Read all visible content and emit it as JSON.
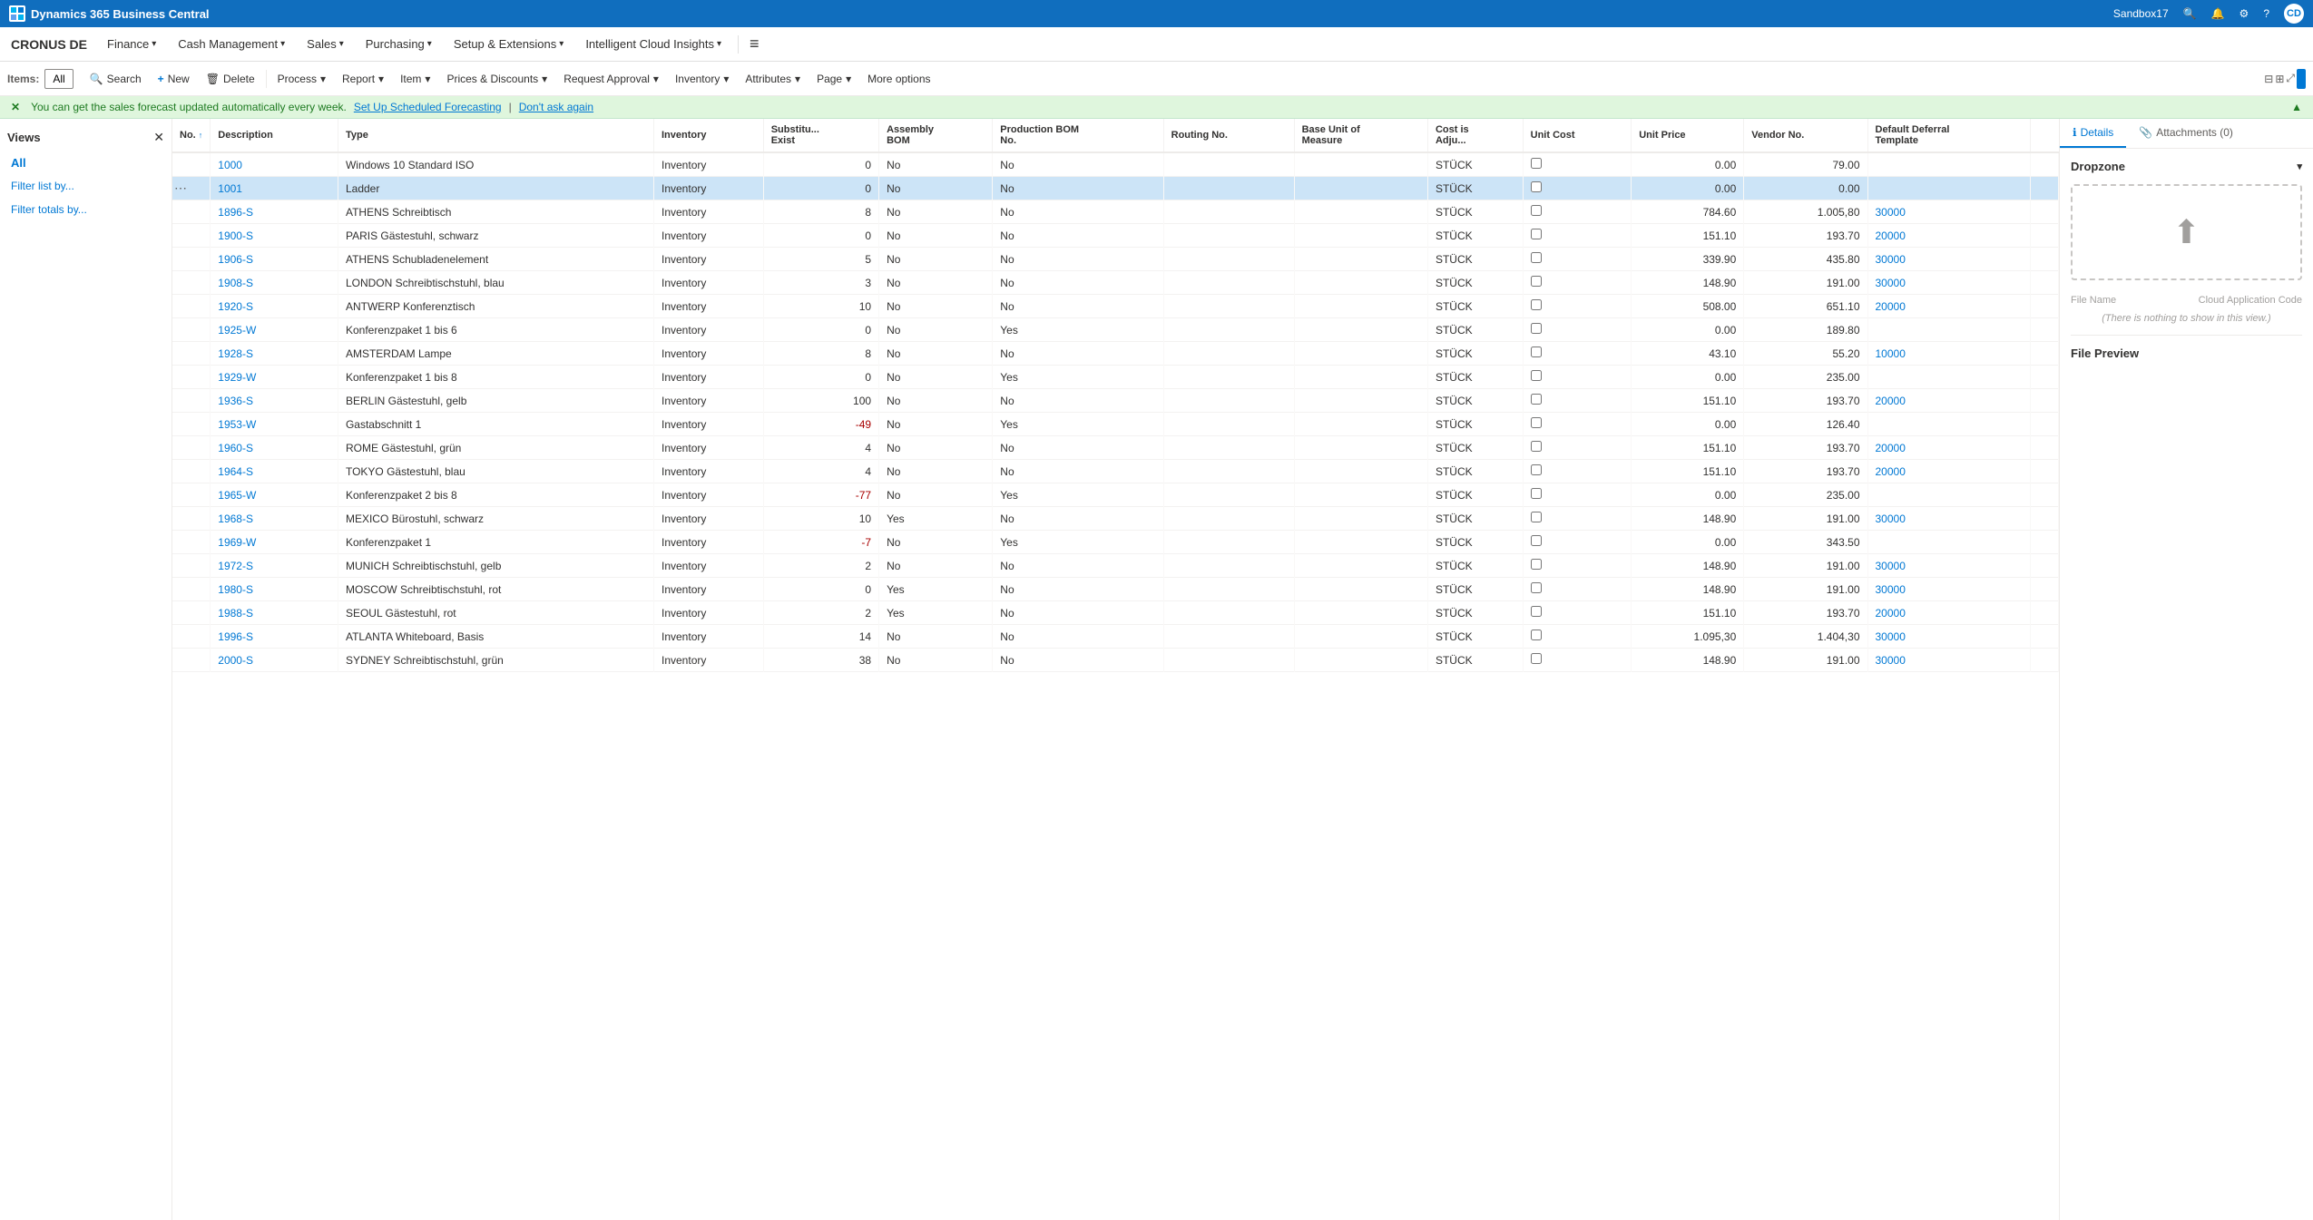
{
  "topBar": {
    "appName": "Dynamics 365 Business Central",
    "sandboxLabel": "Sandbox17",
    "searchIcon": "🔍",
    "bellIcon": "🔔",
    "settingsIcon": "⚙",
    "helpIcon": "?",
    "userIcon": "👤"
  },
  "navBar": {
    "companyName": "CRONUS DE",
    "items": [
      {
        "label": "Finance",
        "hasChevron": true
      },
      {
        "label": "Cash Management",
        "hasChevron": true
      },
      {
        "label": "Sales",
        "hasChevron": true
      },
      {
        "label": "Purchasing",
        "hasChevron": true
      },
      {
        "label": "Setup & Extensions",
        "hasChevron": true
      },
      {
        "label": "Intelligent Cloud Insights",
        "hasChevron": true
      }
    ]
  },
  "toolbar": {
    "itemsLabel": "Items:",
    "filterAll": "All",
    "buttons": [
      {
        "id": "search",
        "icon": "🔍",
        "label": "Search"
      },
      {
        "id": "new",
        "icon": "+",
        "label": "New"
      },
      {
        "id": "delete",
        "icon": "🗑",
        "label": "Delete"
      },
      {
        "id": "process",
        "icon": "",
        "label": "Process",
        "hasChevron": true
      },
      {
        "id": "report",
        "icon": "",
        "label": "Report",
        "hasChevron": true
      },
      {
        "id": "item",
        "icon": "",
        "label": "Item",
        "hasChevron": true
      },
      {
        "id": "prices",
        "icon": "",
        "label": "Prices & Discounts",
        "hasChevron": true
      },
      {
        "id": "approval",
        "icon": "",
        "label": "Request Approval",
        "hasChevron": true
      },
      {
        "id": "inventory",
        "icon": "",
        "label": "Inventory",
        "hasChevron": true
      },
      {
        "id": "attributes",
        "icon": "",
        "label": "Attributes",
        "hasChevron": true
      },
      {
        "id": "page",
        "icon": "",
        "label": "Page",
        "hasChevron": true
      },
      {
        "id": "more",
        "icon": "",
        "label": "More options"
      }
    ]
  },
  "banner": {
    "message": "You can get the sales forecast updated automatically every week.",
    "linkText": "Set Up Scheduled Forecasting",
    "dismissText": "Don't ask again"
  },
  "sidebar": {
    "title": "Views",
    "activeView": "All",
    "links": [
      {
        "label": "Filter list by..."
      },
      {
        "label": "Filter totals by..."
      }
    ]
  },
  "table": {
    "columns": [
      {
        "id": "no",
        "label": "No. ↑"
      },
      {
        "id": "description",
        "label": "Description"
      },
      {
        "id": "type",
        "label": "Type"
      },
      {
        "id": "inventory",
        "label": "Inventory"
      },
      {
        "id": "subst",
        "label": "Substitu... Exist"
      },
      {
        "id": "assembly",
        "label": "Assembly BOM"
      },
      {
        "id": "production",
        "label": "Production BOM No."
      },
      {
        "id": "routing",
        "label": "Routing No."
      },
      {
        "id": "baseunit",
        "label": "Base Unit of Measure"
      },
      {
        "id": "costadj",
        "label": "Cost is Adju..."
      },
      {
        "id": "unitcost",
        "label": "Unit Cost"
      },
      {
        "id": "unitprice",
        "label": "Unit Price"
      },
      {
        "id": "vendor",
        "label": "Vendor No."
      },
      {
        "id": "deferral",
        "label": "Default Deferral Template"
      }
    ],
    "rows": [
      {
        "no": "1000",
        "description": "Windows 10 Standard ISO",
        "type": "Inventory",
        "inventory": "0",
        "subst": "No",
        "assembly": "No",
        "production": "",
        "routing": "",
        "baseunit": "STÜCK",
        "costadj": "",
        "unitcost": "0.00",
        "unitprice": "79.00",
        "vendor": "",
        "deferral": "",
        "selected": false
      },
      {
        "no": "1001",
        "description": "Ladder",
        "type": "Inventory",
        "inventory": "0",
        "subst": "No",
        "assembly": "No",
        "production": "",
        "routing": "",
        "baseunit": "STÜCK",
        "costadj": "",
        "unitcost": "0.00",
        "unitprice": "0.00",
        "vendor": "",
        "deferral": "",
        "selected": true
      },
      {
        "no": "1896-S",
        "description": "ATHENS Schreibtisch",
        "type": "Inventory",
        "inventory": "8",
        "subst": "No",
        "assembly": "No",
        "production": "",
        "routing": "",
        "baseunit": "STÜCK",
        "costadj": "",
        "unitcost": "784.60",
        "unitprice": "1.005,80",
        "vendor": "30000",
        "deferral": "",
        "selected": false
      },
      {
        "no": "1900-S",
        "description": "PARIS Gästestuhl, schwarz",
        "type": "Inventory",
        "inventory": "0",
        "subst": "No",
        "assembly": "No",
        "production": "",
        "routing": "",
        "baseunit": "STÜCK",
        "costadj": "",
        "unitcost": "151.10",
        "unitprice": "193.70",
        "vendor": "20000",
        "deferral": "",
        "selected": false
      },
      {
        "no": "1906-S",
        "description": "ATHENS Schubladenelement",
        "type": "Inventory",
        "inventory": "5",
        "subst": "No",
        "assembly": "No",
        "production": "",
        "routing": "",
        "baseunit": "STÜCK",
        "costadj": "",
        "unitcost": "339.90",
        "unitprice": "435.80",
        "vendor": "30000",
        "deferral": "",
        "selected": false
      },
      {
        "no": "1908-S",
        "description": "LONDON Schreibtischstuhl, blau",
        "type": "Inventory",
        "inventory": "3",
        "subst": "No",
        "assembly": "No",
        "production": "",
        "routing": "",
        "baseunit": "STÜCK",
        "costadj": "",
        "unitcost": "148.90",
        "unitprice": "191.00",
        "vendor": "30000",
        "deferral": "",
        "selected": false
      },
      {
        "no": "1920-S",
        "description": "ANTWERP Konferenztisch",
        "type": "Inventory",
        "inventory": "10",
        "subst": "No",
        "assembly": "No",
        "production": "",
        "routing": "",
        "baseunit": "STÜCK",
        "costadj": "",
        "unitcost": "508.00",
        "unitprice": "651.10",
        "vendor": "20000",
        "deferral": "",
        "selected": false
      },
      {
        "no": "1925-W",
        "description": "Konferenzpaket 1 bis 6",
        "type": "Inventory",
        "inventory": "0",
        "subst": "No",
        "assembly": "Yes",
        "production": "",
        "routing": "",
        "baseunit": "STÜCK",
        "costadj": "",
        "unitcost": "0.00",
        "unitprice": "189.80",
        "vendor": "",
        "deferral": "",
        "selected": false
      },
      {
        "no": "1928-S",
        "description": "AMSTERDAM Lampe",
        "type": "Inventory",
        "inventory": "8",
        "subst": "No",
        "assembly": "No",
        "production": "",
        "routing": "",
        "baseunit": "STÜCK",
        "costadj": "",
        "unitcost": "43.10",
        "unitprice": "55.20",
        "vendor": "10000",
        "deferral": "",
        "selected": false
      },
      {
        "no": "1929-W",
        "description": "Konferenzpaket 1 bis 8",
        "type": "Inventory",
        "inventory": "0",
        "subst": "No",
        "assembly": "Yes",
        "production": "",
        "routing": "",
        "baseunit": "STÜCK",
        "costadj": "",
        "unitcost": "0.00",
        "unitprice": "235.00",
        "vendor": "",
        "deferral": "",
        "selected": false
      },
      {
        "no": "1936-S",
        "description": "BERLIN Gästestuhl, gelb",
        "type": "Inventory",
        "inventory": "100",
        "subst": "No",
        "assembly": "No",
        "production": "",
        "routing": "",
        "baseunit": "STÜCK",
        "costadj": "",
        "unitcost": "151.10",
        "unitprice": "193.70",
        "vendor": "20000",
        "deferral": "",
        "selected": false
      },
      {
        "no": "1953-W",
        "description": "Gastabschnitt 1",
        "type": "Inventory",
        "inventory": "-49",
        "subst": "No",
        "assembly": "Yes",
        "production": "",
        "routing": "",
        "baseunit": "STÜCK",
        "costadj": "",
        "unitcost": "0.00",
        "unitprice": "126.40",
        "vendor": "",
        "deferral": "",
        "selected": false
      },
      {
        "no": "1960-S",
        "description": "ROME Gästestuhl, grün",
        "type": "Inventory",
        "inventory": "4",
        "subst": "No",
        "assembly": "No",
        "production": "",
        "routing": "",
        "baseunit": "STÜCK",
        "costadj": "",
        "unitcost": "151.10",
        "unitprice": "193.70",
        "vendor": "20000",
        "deferral": "",
        "selected": false
      },
      {
        "no": "1964-S",
        "description": "TOKYO Gästestuhl, blau",
        "type": "Inventory",
        "inventory": "4",
        "subst": "No",
        "assembly": "No",
        "production": "",
        "routing": "",
        "baseunit": "STÜCK",
        "costadj": "",
        "unitcost": "151.10",
        "unitprice": "193.70",
        "vendor": "20000",
        "deferral": "",
        "selected": false
      },
      {
        "no": "1965-W",
        "description": "Konferenzpaket 2 bis 8",
        "type": "Inventory",
        "inventory": "-77",
        "subst": "No",
        "assembly": "Yes",
        "production": "",
        "routing": "",
        "baseunit": "STÜCK",
        "costadj": "",
        "unitcost": "0.00",
        "unitprice": "235.00",
        "vendor": "",
        "deferral": "",
        "selected": false
      },
      {
        "no": "1968-S",
        "description": "MEXICO Bürostuhl, schwarz",
        "type": "Inventory",
        "inventory": "10",
        "subst": "Yes",
        "assembly": "No",
        "production": "",
        "routing": "",
        "baseunit": "STÜCK",
        "costadj": "",
        "unitcost": "148.90",
        "unitprice": "191.00",
        "vendor": "30000",
        "deferral": "",
        "selected": false
      },
      {
        "no": "1969-W",
        "description": "Konferenzpaket 1",
        "type": "Inventory",
        "inventory": "-7",
        "subst": "No",
        "assembly": "Yes",
        "production": "",
        "routing": "",
        "baseunit": "STÜCK",
        "costadj": "",
        "unitcost": "0.00",
        "unitprice": "343.50",
        "vendor": "",
        "deferral": "",
        "selected": false
      },
      {
        "no": "1972-S",
        "description": "MUNICH Schreibtischstuhl, gelb",
        "type": "Inventory",
        "inventory": "2",
        "subst": "No",
        "assembly": "No",
        "production": "",
        "routing": "",
        "baseunit": "STÜCK",
        "costadj": "",
        "unitcost": "148.90",
        "unitprice": "191.00",
        "vendor": "30000",
        "deferral": "",
        "selected": false
      },
      {
        "no": "1980-S",
        "description": "MOSCOW Schreibtischstuhl, rot",
        "type": "Inventory",
        "inventory": "0",
        "subst": "Yes",
        "assembly": "No",
        "production": "",
        "routing": "",
        "baseunit": "STÜCK",
        "costadj": "",
        "unitcost": "148.90",
        "unitprice": "191.00",
        "vendor": "30000",
        "deferral": "",
        "selected": false
      },
      {
        "no": "1988-S",
        "description": "SEOUL Gästestuhl, rot",
        "type": "Inventory",
        "inventory": "2",
        "subst": "Yes",
        "assembly": "No",
        "production": "",
        "routing": "",
        "baseunit": "STÜCK",
        "costadj": "",
        "unitcost": "151.10",
        "unitprice": "193.70",
        "vendor": "20000",
        "deferral": "",
        "selected": false
      },
      {
        "no": "1996-S",
        "description": "ATLANTA Whiteboard, Basis",
        "type": "Inventory",
        "inventory": "14",
        "subst": "No",
        "assembly": "No",
        "production": "",
        "routing": "",
        "baseunit": "STÜCK",
        "costadj": "",
        "unitcost": "1.095,30",
        "unitprice": "1.404,30",
        "vendor": "30000",
        "deferral": "",
        "selected": false
      },
      {
        "no": "2000-S",
        "description": "SYDNEY Schreibtischstuhl, grün",
        "type": "Inventory",
        "inventory": "38",
        "subst": "No",
        "assembly": "No",
        "production": "",
        "routing": "",
        "baseunit": "STÜCK",
        "costadj": "",
        "unitcost": "148.90",
        "unitprice": "191.00",
        "vendor": "30000",
        "deferral": "",
        "selected": false
      }
    ]
  },
  "rightPanel": {
    "tabs": [
      {
        "id": "details",
        "label": "Details",
        "icon": "ℹ"
      },
      {
        "id": "attachments",
        "label": "Attachments (0)",
        "icon": "📎"
      }
    ],
    "dropzoneLabel": "Dropzone",
    "fileNameLabel": "File Name",
    "cloudAppCodeLabel": "Cloud Application Code",
    "emptyText": "(There is nothing to show in this view.)",
    "filePreviewLabel": "File Preview"
  }
}
